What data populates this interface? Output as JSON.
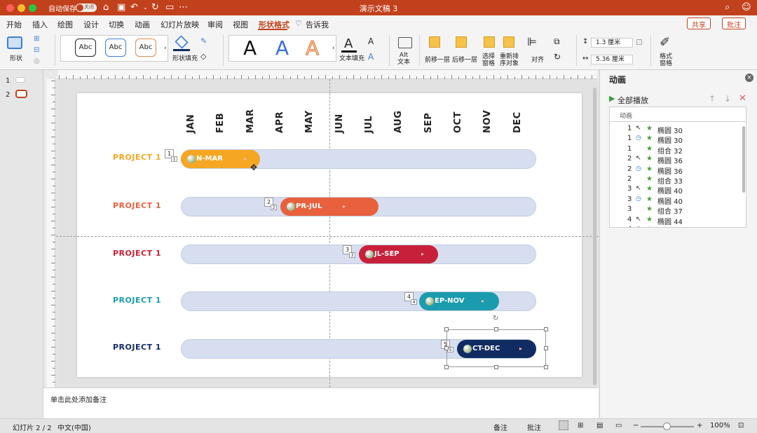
{
  "titlebar": {
    "autosave": "自动保存",
    "toggle": "关闭",
    "doc_title": "演示文稿 3"
  },
  "colors": {
    "accent": "#c1411c",
    "orange": "#f5a623",
    "coral": "#e8613c",
    "red": "#c8203a",
    "teal": "#1a9cae",
    "navy": "#112b63",
    "track": "#d6def0"
  },
  "menu": {
    "items": [
      "开始",
      "插入",
      "绘图",
      "设计",
      "切换",
      "动画",
      "幻灯片放映",
      "审阅",
      "视图",
      "形状格式"
    ],
    "tell": "告诉我",
    "share": "共享",
    "comments": "批注"
  },
  "ribbon": {
    "shape": "形状",
    "shape_fill": "形状填充",
    "style_abc": "Abc",
    "big_a": "A",
    "text_fill": "文本填充",
    "alt_text": "Alt\n文本",
    "bring_forward": "前移一层",
    "send_backward": "后移一层",
    "selection_pane": "选择\n窗格",
    "reorder": "重新排\n序对象",
    "align": "对齐",
    "height": "1.3 厘米",
    "width": "5.36 厘米",
    "format_pane": "格式\n窗格"
  },
  "thumbs": {
    "n1": "1",
    "n2": "2"
  },
  "slide": {
    "months": [
      "JAN",
      "FEB",
      "MAR",
      "APR",
      "MAY",
      "JUN",
      "JUL",
      "AUG",
      "SEP",
      "OCT",
      "NOV",
      "DEC"
    ],
    "projects": [
      {
        "name": "PROJECT 1",
        "label": "N-MAR",
        "tag": "1",
        "tag2": "1"
      },
      {
        "name": "PROJECT 1",
        "label": "PR-JUL",
        "tag": "2",
        "tag2": "2"
      },
      {
        "name": "PROJECT 1",
        "label": "JL-SEP",
        "tag": "3",
        "tag2": "3"
      },
      {
        "name": "PROJECT 1",
        "label": "EP-NOV",
        "tag": "4",
        "tag2": "4"
      },
      {
        "name": "PROJECT 1",
        "label": "CT-DEC",
        "tag": "5",
        "tag2": "5"
      }
    ]
  },
  "notes": {
    "placeholder": "单击此处添加备注"
  },
  "panel": {
    "title": "动画",
    "play_all": "全部播放",
    "list_header": "动画",
    "rows": [
      {
        "n": "1",
        "icon": "pointer",
        "name": "椭圆 30"
      },
      {
        "n": "1",
        "icon": "clock",
        "name": "椭圆 30"
      },
      {
        "n": "1",
        "icon": "",
        "name": "组合 32"
      },
      {
        "n": "2",
        "icon": "pointer",
        "name": "椭圆 36"
      },
      {
        "n": "2",
        "icon": "clock",
        "name": "椭圆 36"
      },
      {
        "n": "2",
        "icon": "",
        "name": "组合 33"
      },
      {
        "n": "3",
        "icon": "pointer",
        "name": "椭圆 40"
      },
      {
        "n": "3",
        "icon": "clock",
        "name": "椭圆 40"
      },
      {
        "n": "3",
        "icon": "",
        "name": "组合 37"
      },
      {
        "n": "4",
        "icon": "pointer",
        "name": "椭圆 44"
      },
      {
        "n": "4",
        "icon": "clock",
        "name": "椭圆 44"
      }
    ]
  },
  "status": {
    "slide": "幻灯片 2 / 2",
    "lang": "中文(中国)",
    "notes": "备注",
    "comments": "批注",
    "zoom": "100%"
  }
}
